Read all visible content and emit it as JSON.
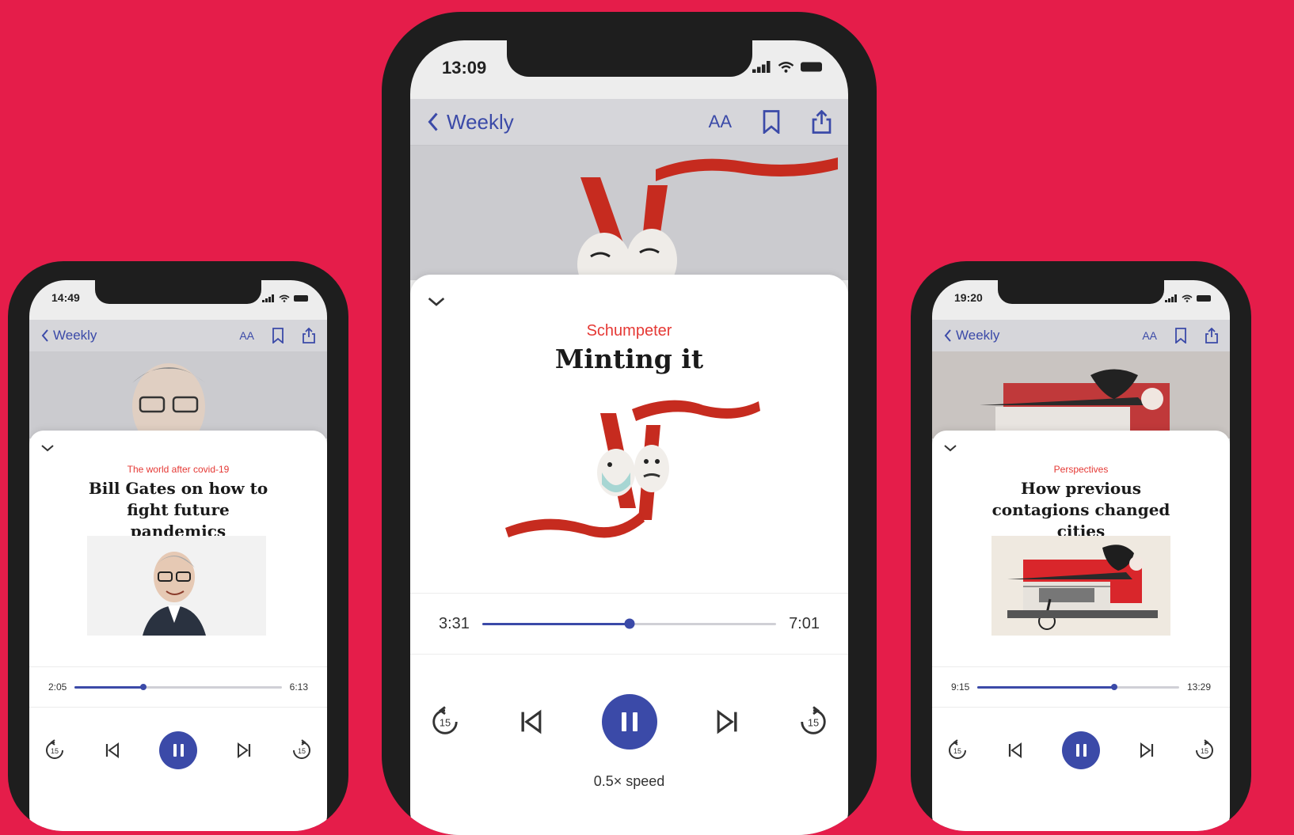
{
  "colors": {
    "background": "#e51d4a",
    "accent": "#3b4aa8",
    "kicker": "#e53935"
  },
  "phones": {
    "left": {
      "time": "14:49",
      "back_label": "Weekly",
      "text_size_label": "AA",
      "kicker": "The world after covid-19",
      "title": "Bill Gates on how to fight future pandemics",
      "elapsed": "2:05",
      "duration": "6:13",
      "progress": 0.33
    },
    "center": {
      "time": "13:09",
      "back_label": "Weekly",
      "text_size_label": "AA",
      "kicker": "Schumpeter",
      "title": "Minting it",
      "elapsed": "3:31",
      "duration": "7:01",
      "progress": 0.5,
      "speed": "0.5× speed"
    },
    "right": {
      "time": "19:20",
      "back_label": "Weekly",
      "text_size_label": "AA",
      "kicker": "Perspectives",
      "title": "How previous contagions changed cities",
      "elapsed": "9:15",
      "duration": "13:29",
      "progress": 0.68
    }
  },
  "icons": {
    "back": "chevron-left-icon",
    "text_size": "text-size-icon",
    "bookmark": "bookmark-icon",
    "share": "share-icon",
    "collapse": "chevron-down-icon",
    "rewind": "rewind-15-icon",
    "previous": "skip-previous-icon",
    "pause": "pause-icon",
    "next": "skip-next-icon",
    "forward": "forward-15-icon"
  }
}
